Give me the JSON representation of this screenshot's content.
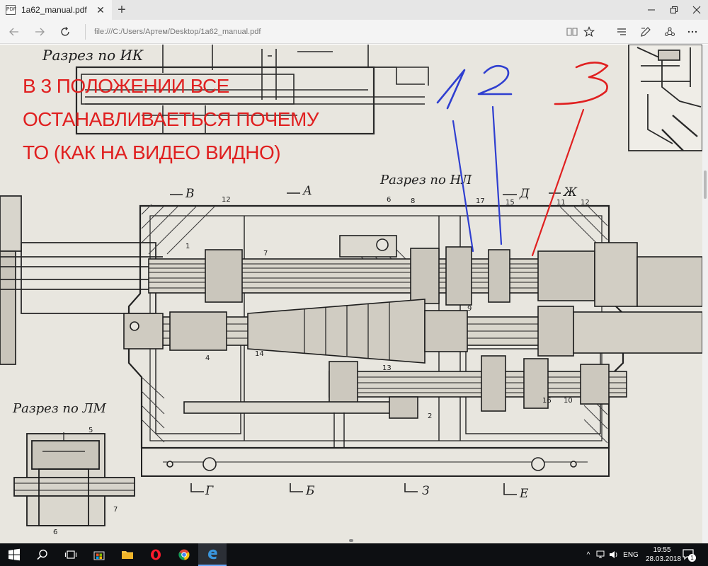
{
  "browser": {
    "tab_title": "1a62_manual.pdf",
    "tab_favicon": "PDF",
    "address": "file:///C:/Users/Артем/Desktop/1a62_manual.pdf"
  },
  "annotation": {
    "lines": [
      "В 3 ПОЛОЖЕНИИ ВСЕ",
      "ОСТАНАВЛИВАЕТЬСЯ ПОЧЕМУ",
      "ТО (КАК НА ВИДЕО ВИДНО)"
    ],
    "color": "#e02020",
    "markers": [
      {
        "label": "1",
        "color": "#2f3fd0"
      },
      {
        "label": "2",
        "color": "#2f3fd0"
      },
      {
        "label": "3",
        "color": "#e02020"
      }
    ]
  },
  "drawing": {
    "section_labels": {
      "ik": "Разрез по ИК",
      "nl": "Разрез по НЛ",
      "lm": "Разрез по ЛМ"
    },
    "cut_letters": {
      "v": "В",
      "a": "А",
      "d": "Д",
      "zh": "Ж",
      "g": "Г",
      "b": "Б",
      "z": "З",
      "e": "Е"
    },
    "part_numbers": {
      "p1": "1",
      "p2": "2",
      "p4": "4",
      "p5": "5",
      "p6": "6",
      "p6b": "6",
      "p7": "7",
      "p7b": "7",
      "p8": "8",
      "p9": "9",
      "p10": "10",
      "p12": "12",
      "p12b": "12",
      "p13": "13",
      "p14": "14",
      "p15": "15",
      "p16": "16",
      "p17": "17",
      "p11": "11"
    }
  },
  "taskbar": {
    "language": "ENG",
    "time": "19:55",
    "date": "28.03.2018",
    "notification_count": "1"
  }
}
